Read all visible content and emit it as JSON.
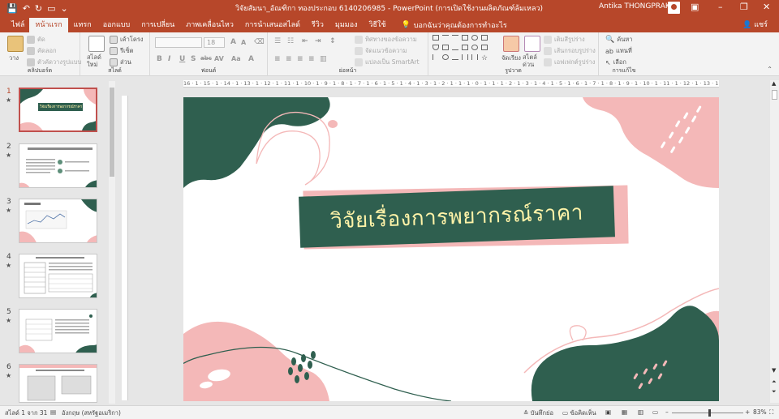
{
  "titlebar": {
    "doc_title": "วิจัยสัมนา_อัณฑิกา ทองประกอบ 6140206985  -  PowerPoint (การเปิดใช้งานผลิตภัณฑ์ล้มเหลว)",
    "user_name": "Antika THONGPRAKOB",
    "minimize": "–",
    "restore": "❐",
    "close": "✕"
  },
  "tabs": [
    {
      "label": "ไฟล์"
    },
    {
      "label": "หน้าแรก",
      "active": true
    },
    {
      "label": "แทรก"
    },
    {
      "label": "ออกแบบ"
    },
    {
      "label": "การเปลี่ยน"
    },
    {
      "label": "ภาพเคลื่อนไหว"
    },
    {
      "label": "การนำเสนอสไลด์"
    },
    {
      "label": "รีวิว"
    },
    {
      "label": "มุมมอง"
    },
    {
      "label": "วิธีใช้"
    }
  ],
  "tell_me": "บอกฉันว่าคุณต้องการทำอะไร",
  "share": "แชร์",
  "ribbon": {
    "clipboard": {
      "paste": "วาง",
      "cut": "ตัด",
      "copy": "คัดลอก",
      "format_painter": "ตัวคัดวางรูปแบบ",
      "label": "คลิปบอร์ด"
    },
    "slides": {
      "new_slide": "สไลด์ใหม่",
      "layout": "เค้าโครง",
      "reset": "รีเซ็ต",
      "section": "ส่วน",
      "label": "สไลด์"
    },
    "font": {
      "font_name": "",
      "font_size": "18",
      "label": "ฟอนต์",
      "bold": "B",
      "italic": "I",
      "underline": "U",
      "shadow": "S",
      "strike": "abc",
      "spacing": "AV",
      "case": "Aa",
      "color": "A"
    },
    "paragraph": {
      "text_direction": "ทิศทางของข้อความ",
      "align_text": "จัดแนวข้อความ",
      "smartart": "แปลงเป็น SmartArt",
      "label": "ย่อหน้า"
    },
    "drawing": {
      "arrange": "จัดเรียง",
      "quick_styles": "สไตล์ด่วน",
      "shape_fill": "เติมสีรูปร่าง",
      "shape_outline": "เส้นกรอบรูปร่าง",
      "shape_effects": "เอฟเฟกต์รูปร่าง",
      "label": "รูปวาด"
    },
    "editing": {
      "find": "ค้นหา",
      "replace": "แทนที่",
      "select": "เลือก",
      "label": "การแก้ไข"
    }
  },
  "thumbnails": [
    {
      "num": "1",
      "star": "★",
      "selected": true,
      "title": "วิจัยเรื่องการพยากรณ์ราคา"
    },
    {
      "num": "2",
      "star": "★"
    },
    {
      "num": "3",
      "star": "★"
    },
    {
      "num": "4",
      "star": "★"
    },
    {
      "num": "5",
      "star": "★"
    },
    {
      "num": "6",
      "star": "★"
    }
  ],
  "ruler_ticks": "16 · 1 · 15 · 1 · 14 · 1 · 13 · 1 · 12 · 1 · 11 · 1 · 10 · 1 · 9 · 1 · 8 · 1 · 7 · 1 · 6 · 1 · 5 · 1 · 4 · 1 · 3 · 1 · 2 · 1 · 1 · 1 · 0 · 1 · 1 · 1 · 2 · 1 · 3 · 1 · 4 · 1 · 5 · 1 · 6 · 1 · 7 · 1 · 8 · 1 · 9 · 1 · 10 · 1 · 11 · 1 · 12 · 1 · 13 · 1 · 14 · 1 · 15 · 1 · 16",
  "slide": {
    "title": "วิจัยเรื่องการพยากรณ์ราคา",
    "colors": {
      "green": "#2f5f4f",
      "pink": "#f4b8b8",
      "title_text": "#fff3a8"
    }
  },
  "statusbar": {
    "slide_info": "สไลด์ 1 จาก 31",
    "language": "อังกฤษ (สหรัฐอเมริกา)",
    "notes": "บันทึกย่อ",
    "comments": "ข้อคิดเห็น",
    "zoom": "83%",
    "zoom_minus": "–",
    "zoom_plus": "+"
  },
  "accent_color": "#b7472a"
}
